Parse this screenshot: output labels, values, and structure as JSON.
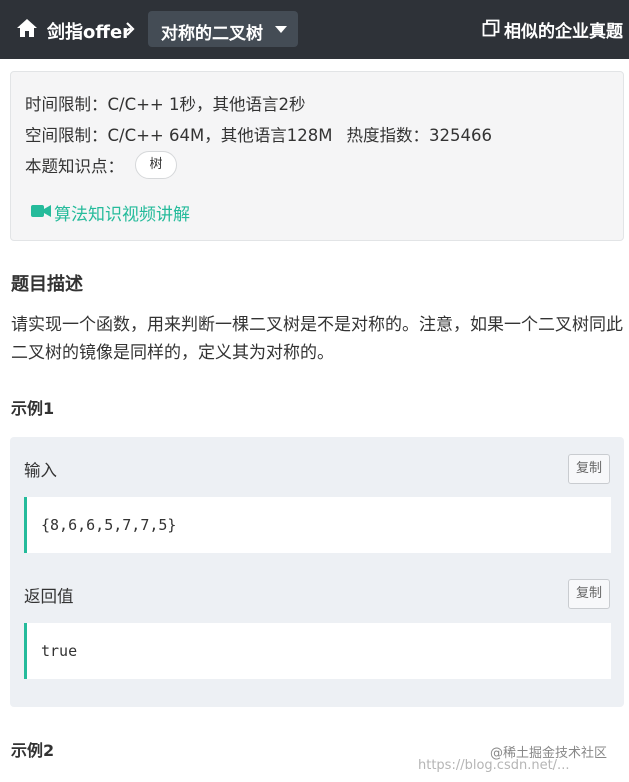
{
  "header": {
    "breadcrumb_label": "剑指offer",
    "problem_title": "对称的二叉树",
    "similar_label": "相似的企业真题"
  },
  "info": {
    "time_limit": "时间限制：C/C++ 1秒，其他语言2秒",
    "space_limit": "空间限制：C/C++ 64M，其他语言128M",
    "heat_label": "热度指数：325466",
    "knowledge_label": "本题知识点：",
    "tag": "树",
    "video_label": "算法知识视频讲解"
  },
  "description": {
    "title": "题目描述",
    "text": "请实现一个函数，用来判断一棵二叉树是不是对称的。注意，如果一个二叉树同此二叉树的镜像是同样的，定义其为对称的。"
  },
  "examples": [
    {
      "title": "示例1",
      "input_label": "输入",
      "input_value": "{8,6,6,5,7,7,5}",
      "output_label": "返回值",
      "output_value": "true",
      "copy_label": "复制"
    },
    {
      "title": "示例2"
    }
  ],
  "watermark": {
    "line1": "@稀土掘金技术社区",
    "line2": "https://blog.csdn.net/..."
  },
  "colors": {
    "topbar": "#2e3238",
    "accent": "#25bb9b"
  }
}
